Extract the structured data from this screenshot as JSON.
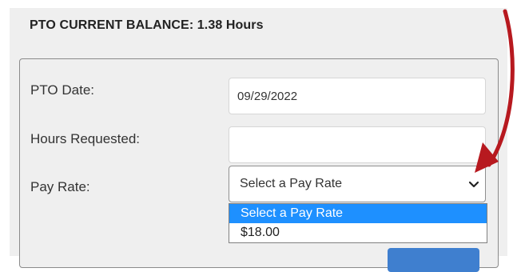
{
  "header": {
    "balance_title": "PTO CURRENT BALANCE: 1.38 Hours"
  },
  "form": {
    "pto_date": {
      "label": "PTO Date:",
      "value": "09/29/2022"
    },
    "hours_requested": {
      "label": "Hours Requested:",
      "value": ""
    },
    "pay_rate": {
      "label": "Pay Rate:",
      "selected": "Select a Pay Rate",
      "options": [
        "Select a Pay Rate",
        "$18.00"
      ]
    }
  },
  "colors": {
    "panel_background": "#efefef",
    "dropdown_highlight": "#1e90ff",
    "submit_button": "#3f7fcf",
    "annotation_arrow": "#b7191f"
  },
  "icons": {
    "select_toggle": "chevron-down-icon",
    "annotation": "curved-arrow-icon"
  }
}
